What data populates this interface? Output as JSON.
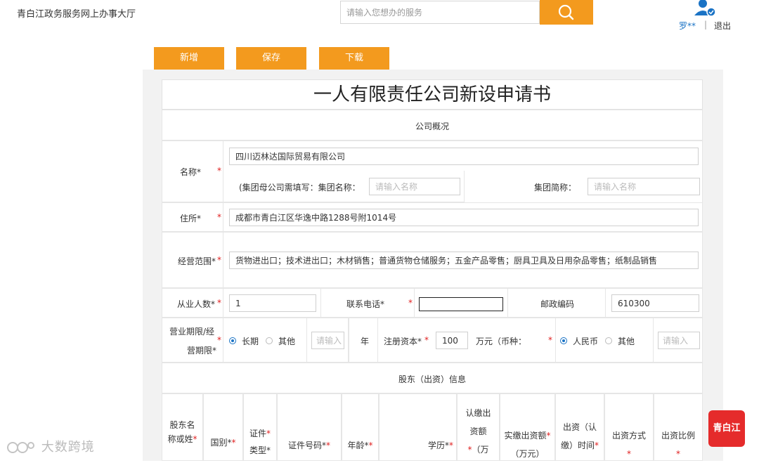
{
  "header": {
    "site_title": "青白江政务服务网上办事大厅",
    "search_placeholder": "请输入您想办的服务",
    "user_name": "罗**",
    "separator": "|",
    "logout_label": "退出"
  },
  "toolbar": {
    "add_label": "新增",
    "save_label": "保存",
    "download_label": "下载"
  },
  "form": {
    "title": "一人有限责任公司新设申请书",
    "section_company": "公司概况",
    "name": {
      "label": "名称*",
      "req": "*",
      "value": "四川迈林达国际贸易有限公司",
      "group_note": "(集团母公司需填写：集团名称：",
      "group_name_placeholder": "请输入名称",
      "group_short_label": "集团简称：",
      "group_short_placeholder": "请输入名称"
    },
    "address": {
      "label": "住所*",
      "req": "*",
      "value": "成都市青白江区华逸中路1288号附1014号"
    },
    "scope": {
      "label": "经营范围*",
      "req": "*",
      "value": "货物进出口；技术进出口；木材销售；普通货物仓储服务；五金产品零售；厨具卫具及日用杂品零售；纸制品销售"
    },
    "employees": {
      "label": "从业人数*",
      "req": "*",
      "value": "1"
    },
    "phone": {
      "label": "联系电话*",
      "req": "*",
      "value": ""
    },
    "postcode": {
      "label": "邮政编码",
      "value": "610300"
    },
    "term": {
      "label_line1": "营业期限/经",
      "label_line2": "营期限*",
      "req": "*",
      "option_long": "长期",
      "option_other": "其他",
      "years_placeholder": "请输入",
      "years_unit": "年"
    },
    "capital": {
      "label": "注册资本*",
      "req": "*",
      "value": "100",
      "unit": "万元（币种：",
      "req2": "*",
      "option_rmb": "人民币",
      "option_other": "其他",
      "other_placeholder": "请输入"
    },
    "section_shareholder": "股东（出资）信息",
    "shareholder_columns": [
      {
        "l1": "股东名",
        "l2": "称或姓",
        "req": "*"
      },
      {
        "l1": "国别*",
        "l2": "",
        "req": "*"
      },
      {
        "l1": "证件",
        "l2": "类型*",
        "req": "*"
      },
      {
        "l1": "证件号码*",
        "l2": "",
        "req": "*"
      },
      {
        "l1": "年龄*",
        "l2": "",
        "req": "*"
      },
      {
        "l1": "学历*",
        "l2": "",
        "req": "*"
      },
      {
        "l1": "认缴出",
        "l2": "资额",
        "l3": "（万",
        "req": "*"
      },
      {
        "l1": "实缴出资额",
        "l2": "（万元）",
        "req": "*"
      },
      {
        "l1": "出资（认",
        "l2": "缴）时间",
        "req": "*"
      },
      {
        "l1": "出资方式",
        "l2": "",
        "req": "*"
      },
      {
        "l1": "出资比例",
        "l2": "",
        "req": "*"
      }
    ]
  },
  "watermark": "大数跨境",
  "logo_text": "青白江"
}
